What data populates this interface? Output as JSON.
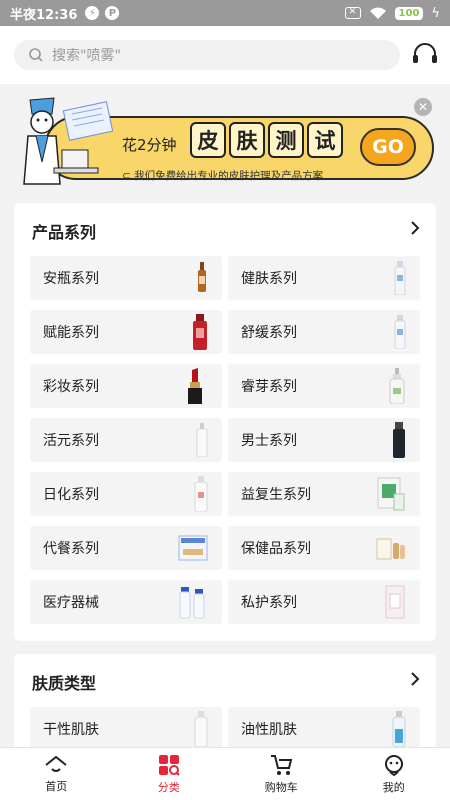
{
  "status_bar": {
    "time": "半夜12:36",
    "battery": "100"
  },
  "search": {
    "placeholder": "搜索\"喷雾\""
  },
  "banner": {
    "prefix": "花2分钟",
    "test_chars": [
      "皮",
      "肤",
      "测",
      "试"
    ],
    "go": "GO",
    "subtitle": "我们免费给出专业的皮肤护理及产品方案"
  },
  "product_series": {
    "title": "产品系列",
    "items": [
      {
        "label": "安瓶系列",
        "icon": "ampoule-bottle"
      },
      {
        "label": "健肤系列",
        "icon": "white-bottle"
      },
      {
        "label": "赋能系列",
        "icon": "red-bottle"
      },
      {
        "label": "舒缓系列",
        "icon": "white-bottle"
      },
      {
        "label": "彩妆系列",
        "icon": "lipstick"
      },
      {
        "label": "睿芽系列",
        "icon": "pump-bottle"
      },
      {
        "label": "活元系列",
        "icon": "white-bottle"
      },
      {
        "label": "男士系列",
        "icon": "black-bottle"
      },
      {
        "label": "日化系列",
        "icon": "white-bottle"
      },
      {
        "label": "益复生系列",
        "icon": "green-box"
      },
      {
        "label": "代餐系列",
        "icon": "meal-box"
      },
      {
        "label": "保健品系列",
        "icon": "supplement-set"
      },
      {
        "label": "医疗器械",
        "icon": "blue-tubes"
      },
      {
        "label": "私护系列",
        "icon": "pink-box"
      }
    ]
  },
  "skin_types": {
    "title": "肤质类型",
    "items": [
      {
        "label": "干性肌肤",
        "icon": "white-bottle"
      },
      {
        "label": "油性肌肤",
        "icon": "blue-bottle"
      }
    ]
  },
  "bottom_nav": [
    {
      "label": "首页",
      "icon": "home-icon"
    },
    {
      "label": "分类",
      "icon": "category-icon",
      "active": true
    },
    {
      "label": "购物车",
      "icon": "cart-icon"
    },
    {
      "label": "我的",
      "icon": "profile-icon"
    }
  ],
  "colors": {
    "accent": "#e6253a",
    "banner_yellow": "#f8d66a",
    "go_orange": "#f6a51e"
  }
}
